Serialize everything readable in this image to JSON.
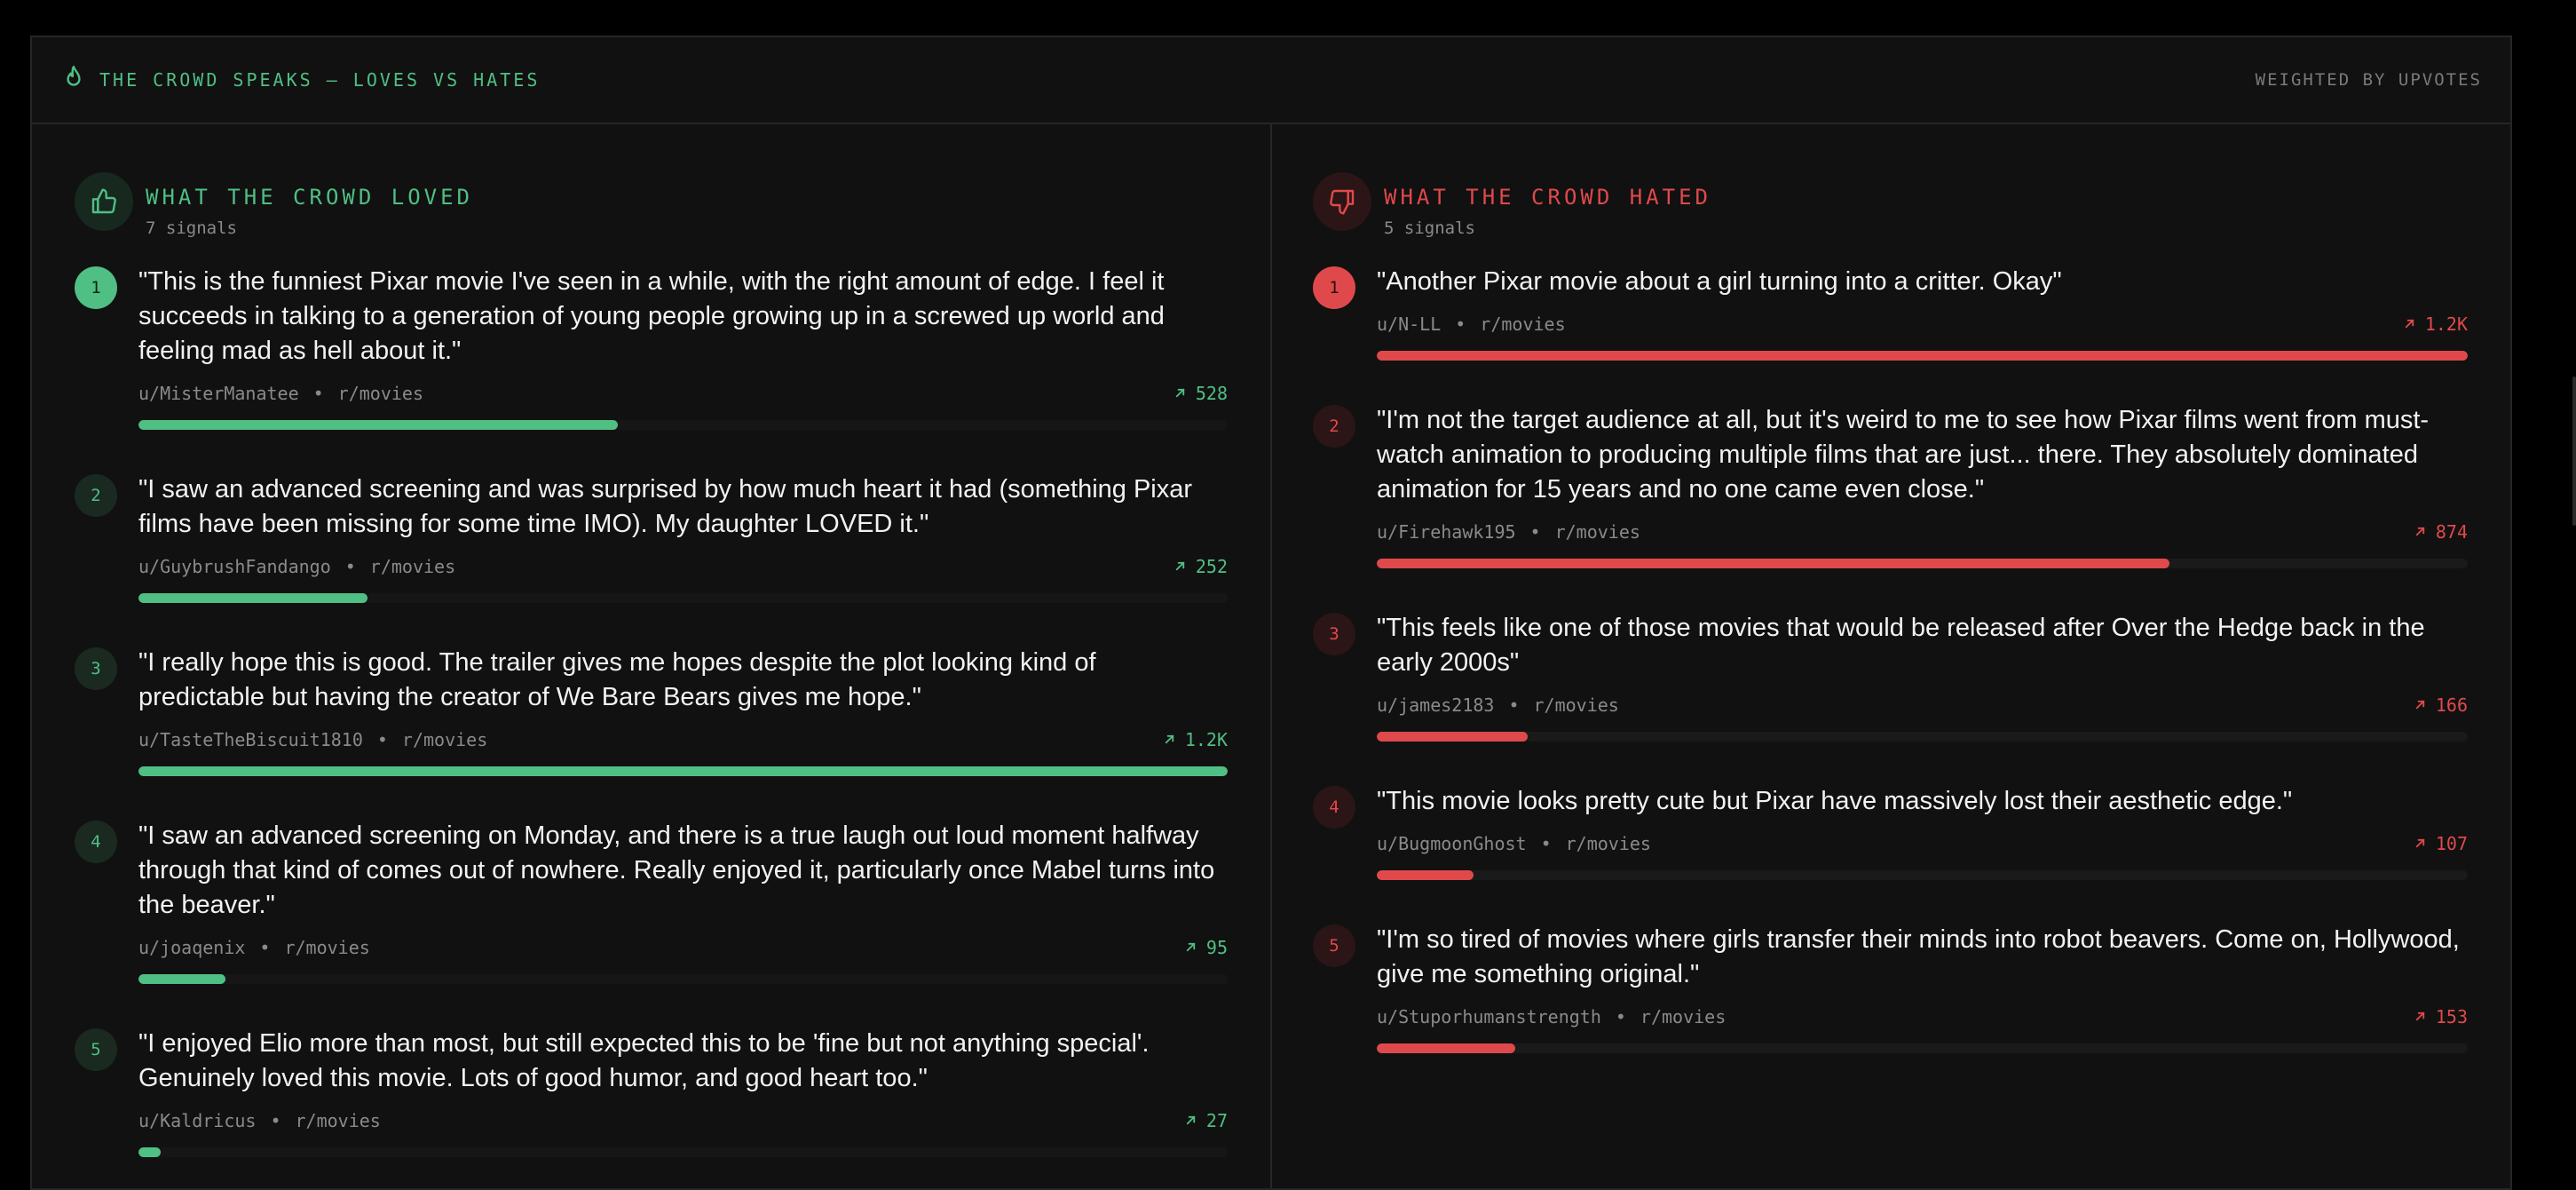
{
  "header": {
    "title": "THE CROWD SPEAKS — LOVES VS HATES",
    "weighted": "WEIGHTED BY UPVOTES"
  },
  "colors": {
    "loved": "#4fbf84",
    "hated": "#e0494b"
  },
  "loved": {
    "title": "WHAT THE CROWD LOVED",
    "count": "7 signals",
    "icon": "thumbs-up-icon",
    "items": [
      {
        "rank": "1",
        "quote": "\"This is the funniest Pixar movie I've seen in a while, with the right amount of edge. I feel it succeeds in talking to a generation of young people growing up in a screwed up world and feeling mad as hell about it.\"",
        "user": "u/MisterManatee",
        "sub": "r/movies",
        "votes": "528",
        "level": 0.44
      },
      {
        "rank": "2",
        "quote": "\"I saw an advanced screening and was surprised by how much heart it had (something Pixar films have been missing for some time IMO). My daughter LOVED it.\"",
        "user": "u/GuybrushFandango",
        "sub": "r/movies",
        "votes": "252",
        "level": 0.21
      },
      {
        "rank": "3",
        "quote": "\"I really hope this is good. The trailer gives me hopes despite the plot looking kind of predictable but having the creator of We Bare Bears gives me hope.\"",
        "user": "u/TasteTheBiscuit1810",
        "sub": "r/movies",
        "votes": "1.2K",
        "level": 1.0
      },
      {
        "rank": "4",
        "quote": "\"I saw an advanced screening on Monday, and there is a true laugh out loud moment halfway through that kind of comes out of nowhere. Really enjoyed it, particularly once Mabel turns into the beaver.\"",
        "user": "u/joaqenix",
        "sub": "r/movies",
        "votes": "95",
        "level": 0.08
      },
      {
        "rank": "5",
        "quote": "\"I enjoyed Elio more than most, but still expected this to be 'fine but not anything special'. Genuinely loved this movie. Lots of good humor, and good heart too.\"",
        "user": "u/Kaldricus",
        "sub": "r/movies",
        "votes": "27",
        "level": 0.02
      }
    ]
  },
  "hated": {
    "title": "WHAT THE CROWD HATED",
    "count": "5 signals",
    "icon": "thumbs-down-icon",
    "items": [
      {
        "rank": "1",
        "quote": "\"Another Pixar movie about a girl turning into a critter. Okay\"",
        "user": "u/N-LL",
        "sub": "r/movies",
        "votes": "1.2K",
        "level": 1.0
      },
      {
        "rank": "2",
        "quote": "\"I'm not the target audience at all, but it's weird to me to see how Pixar films went from must-watch animation to producing multiple films that are just... there. They absolutely dominated animation for 15 years and no one came even close.\"",
        "user": "u/Firehawk195",
        "sub": "r/movies",
        "votes": "874",
        "level": 0.727
      },
      {
        "rank": "3",
        "quote": "\"This feels like one of those movies that would be released after Over the Hedge back in the early 2000s\"",
        "user": "u/james2183",
        "sub": "r/movies",
        "votes": "166",
        "level": 0.138
      },
      {
        "rank": "4",
        "quote": "\"This movie looks pretty cute but Pixar have massively lost their aesthetic edge.\"",
        "user": "u/BugmoonGhost",
        "sub": "r/movies",
        "votes": "107",
        "level": 0.089
      },
      {
        "rank": "5",
        "quote": "\"I'm so tired of movies where girls transfer their minds into robot beavers. Come on, Hollywood, give me something original.\"",
        "user": "u/Stuporhumanstrength",
        "sub": "r/movies",
        "votes": "153",
        "level": 0.127
      }
    ]
  }
}
